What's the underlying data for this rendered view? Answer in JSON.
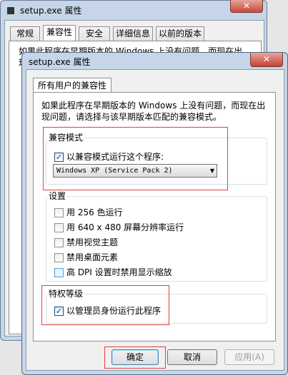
{
  "back_window": {
    "title": "setup.exe 属性",
    "close_glyph": "✕",
    "tabs": [
      {
        "label": "常规"
      },
      {
        "label": "兼容性"
      },
      {
        "label": "安全"
      },
      {
        "label": "详细信息"
      },
      {
        "label": "以前的版本"
      }
    ],
    "partial_text": "如果此程序在早期版本的 Windows 上没有问题，而现在出现问题，请选择与该早期版本匹配的兼容模式。"
  },
  "front_window": {
    "title": "setup.exe 属性",
    "close_glyph": "✕",
    "tab": "所有用户的兼容性",
    "intro": "如果此程序在早期版本的 Windows 上没有问题，而现在出现问题，请选择与该早期版本匹配的兼容模式。",
    "compat_mode": {
      "group_label": "兼容模式",
      "checkbox_label": "以兼容模式运行这个程序:",
      "checked": true,
      "selected_os": "Windows XP (Service Pack 2)"
    },
    "settings": {
      "group_label": "设置",
      "items": [
        {
          "label": "用 256 色运行",
          "checked": false
        },
        {
          "label": "用 640 x 480 屏幕分辨率运行",
          "checked": false
        },
        {
          "label": "禁用视觉主题",
          "checked": false
        },
        {
          "label": "禁用桌面元素",
          "checked": false
        },
        {
          "label": "高 DPI 设置时禁用显示缩放",
          "checked": false
        }
      ]
    },
    "privilege": {
      "group_label": "特权等级",
      "checkbox_label": "以管理员身份运行此程序",
      "checked": true
    },
    "buttons": {
      "ok": "确定",
      "cancel": "取消",
      "apply": "应用(A)"
    },
    "check_glyph": "✓"
  },
  "colors": {
    "highlight_box": "#d9443c",
    "title_bar": "#c6d6e8",
    "close_button": "#c44234"
  }
}
